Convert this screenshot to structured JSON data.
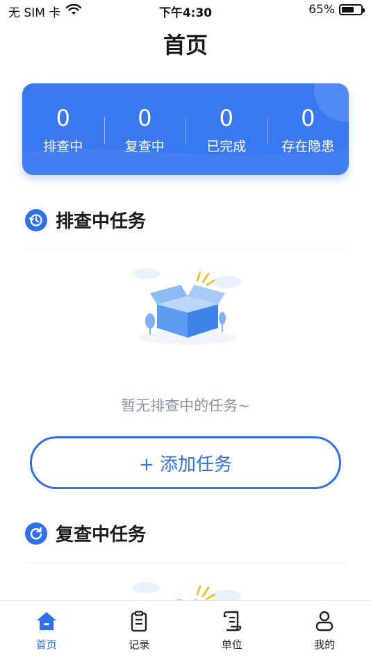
{
  "status_bar": {
    "carrier": "无 SIM 卡",
    "time": "下午4:30",
    "battery": "65%",
    "battery_level": 0.65
  },
  "header": {
    "title": "首页"
  },
  "stats": [
    {
      "value": "0",
      "label": "排查中"
    },
    {
      "value": "0",
      "label": "复查中"
    },
    {
      "value": "0",
      "label": "已完成"
    },
    {
      "value": "0",
      "label": "存在隐患"
    }
  ],
  "sections": {
    "inspecting": {
      "title": "排查中任务",
      "icon": "clock-history-icon",
      "empty_text": "暂无排查中的任务~",
      "add_label": "+ 添加任务"
    },
    "reinspecting": {
      "title": "复查中任务",
      "icon": "refresh-icon"
    }
  },
  "tabbar": {
    "items": [
      {
        "label": "首页",
        "icon": "home-icon",
        "active": true
      },
      {
        "label": "记录",
        "icon": "clipboard-icon",
        "active": false
      },
      {
        "label": "单位",
        "icon": "scroll-document-icon",
        "active": false
      },
      {
        "label": "我的",
        "icon": "user-icon",
        "active": false
      }
    ]
  },
  "colors": {
    "primary": "#2f6fe8",
    "card": "#3a78f0",
    "empty_text": "#8a94a6"
  }
}
